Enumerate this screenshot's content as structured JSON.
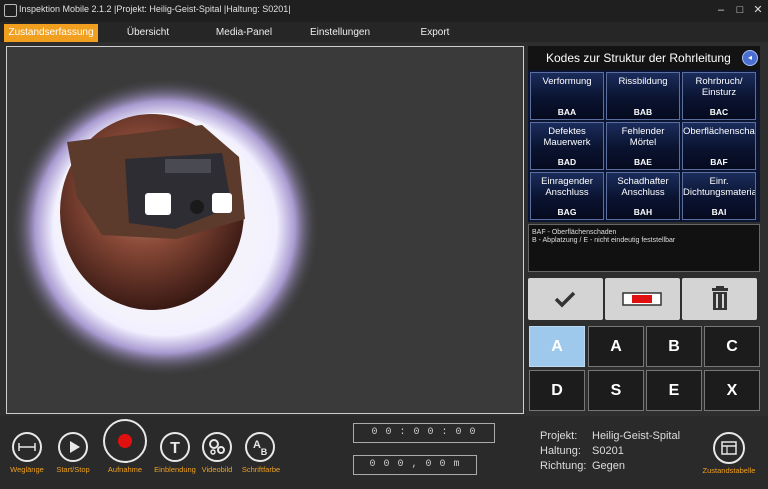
{
  "window": {
    "title": "Inspektion Mobile 2.1.2 |Projekt: Heilig-Geist-Spital |Haltung: S0201|"
  },
  "tabs": [
    "Zustandserfassung",
    "Übersicht",
    "Media-Panel",
    "Einstellungen",
    "Export"
  ],
  "panel": {
    "title": "Kodes zur Struktur der Rohrleitung"
  },
  "codes": [
    {
      "name": "Verformung",
      "code": "BAA"
    },
    {
      "name": "Rissbildung",
      "code": "BAB"
    },
    {
      "name": "Rohrbruch/\nEinsturz",
      "code": "BAC"
    },
    {
      "name": "Defektes\nMauerwerk",
      "code": "BAD"
    },
    {
      "name": "Fehlender\nMörtel",
      "code": "BAE"
    },
    {
      "name": "Oberflächenschad",
      "code": "BAF"
    },
    {
      "name": "Einragender\nAnschluss",
      "code": "BAG"
    },
    {
      "name": "Schadhafter\nAnschluss",
      "code": "BAH"
    },
    {
      "name": "Einr.\nDichtungsmateria",
      "code": "BAI"
    }
  ],
  "description": {
    "line1": "BAF - Oberflächenschaden",
    "line2": "B - Abplatzung / E - nicht eindeutig feststellbar"
  },
  "keys": [
    "A",
    "A",
    "B",
    "C",
    "D",
    "S",
    "E",
    "X"
  ],
  "tools": {
    "weglaenge": "Weglänge",
    "startstop": "Start/Stop",
    "aufnahme": "Aufnahme",
    "einblendung": "Einblendung",
    "videobild": "Videobild",
    "schriftfarbe": "Schriftfarbe"
  },
  "counters": {
    "time": "0 0 : 0 0 : 0 0",
    "distance": "0 0 0 , 0 0 m"
  },
  "info": {
    "projekt_label": "Projekt:",
    "projekt": "Heilig-Geist-Spital",
    "haltung_label": "Haltung:",
    "haltung": "S0201",
    "richtung_label": "Richtung:",
    "richtung": "Gegen"
  },
  "zustandstabelle": "Zustandstabelle",
  "colors": {
    "accent": "#f0a01e",
    "selected_key": "#9ec8ec",
    "record": "#e01010"
  }
}
